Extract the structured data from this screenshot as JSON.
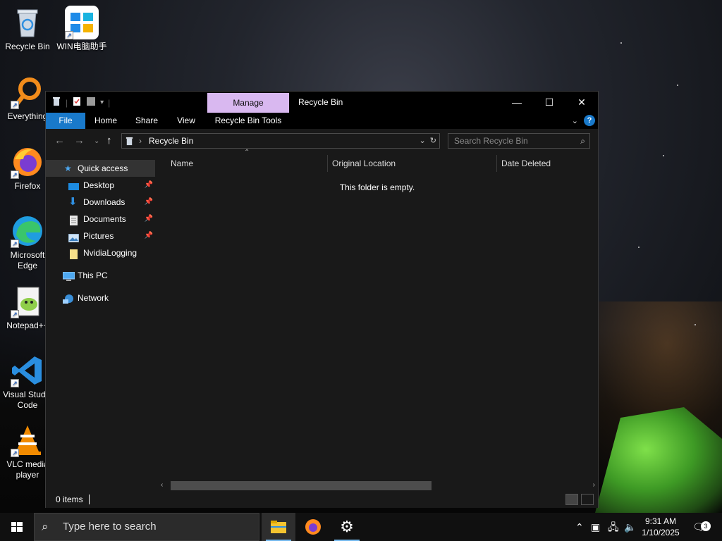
{
  "desktop": {
    "icons": [
      {
        "label": "Recycle Bin"
      },
      {
        "label": "WIN电脑助手"
      },
      {
        "label": "Everything"
      },
      {
        "label": "Firefox"
      },
      {
        "label": "Microsoft Edge"
      },
      {
        "label": "Notepad++"
      },
      {
        "label": "Visual Studio Code"
      },
      {
        "label": "VLC media player"
      }
    ]
  },
  "window": {
    "title": "Recycle Bin",
    "contextual_tab": "Manage",
    "ribbon_tabs": [
      "File",
      "Home",
      "Share",
      "View",
      "Recycle Bin Tools"
    ],
    "help_label": "?",
    "address": {
      "path": "Recycle Bin"
    },
    "search": {
      "placeholder": "Search Recycle Bin"
    },
    "nav_pane": {
      "quick_access": "Quick access",
      "pinned": [
        "Desktop",
        "Downloads",
        "Documents",
        "Pictures"
      ],
      "folder": "NvidiaLogging",
      "this_pc": "This PC",
      "network": "Network"
    },
    "columns": [
      "Name",
      "Original Location",
      "Date Deleted"
    ],
    "empty_message": "This folder is empty.",
    "status": {
      "item_count": "0 items"
    }
  },
  "taskbar": {
    "search_placeholder": "Type here to search",
    "clock_time": "9:31 AM",
    "clock_date": "1/10/2025",
    "notification_count": "3"
  },
  "colors": {
    "accent": "#1979ca",
    "manage_tab": "#d9b8f0",
    "window_bg": "#191919",
    "taskbar_bg": "#101010"
  }
}
